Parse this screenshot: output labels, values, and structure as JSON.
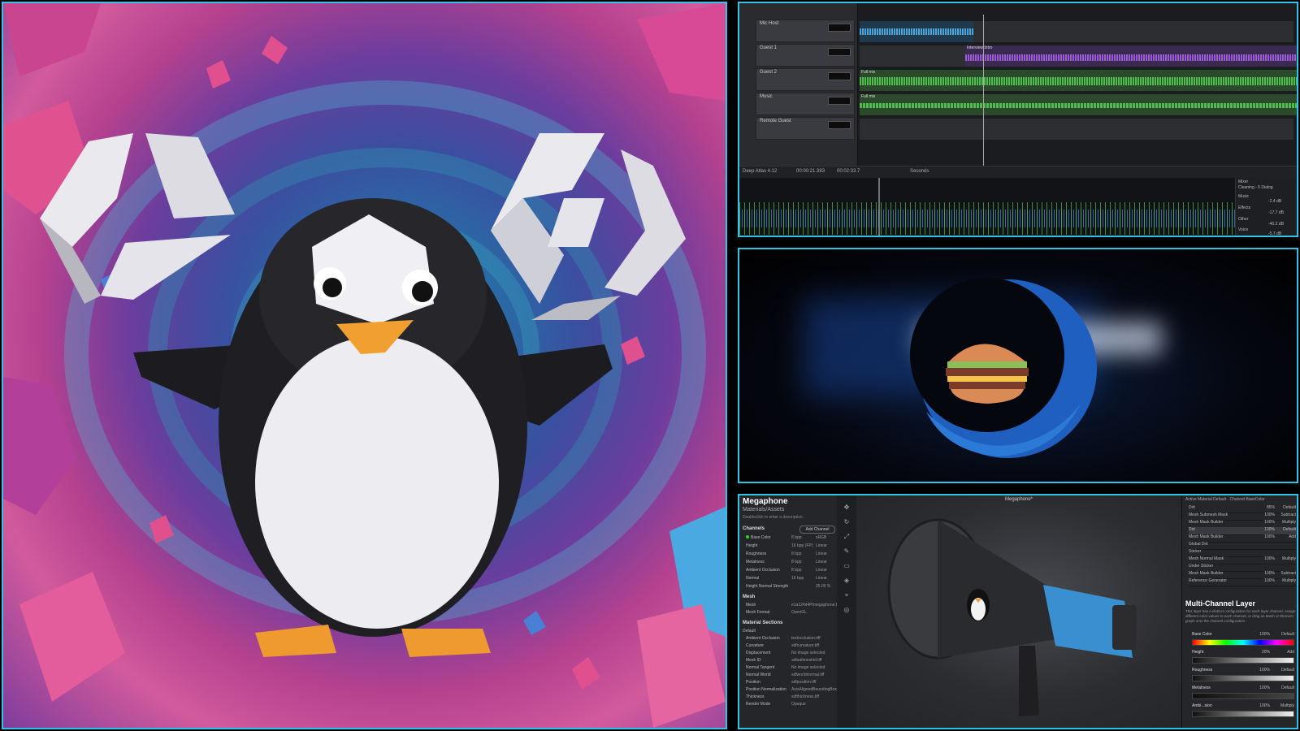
{
  "daw": {
    "tracks": [
      {
        "name": "Mic Host"
      },
      {
        "name": "Guest 1"
      },
      {
        "name": "Guest 2"
      },
      {
        "name": "Music"
      },
      {
        "name": "Remote Guest"
      }
    ],
    "lane_clips": [
      {
        "label": "",
        "color": "#4aa6d6"
      },
      {
        "label": "Interview Intro",
        "color": "#9b5bd6"
      },
      {
        "label": "Full mix",
        "color": "#4fbf4f"
      },
      {
        "label": "Full mix",
        "color": "#4fbf4f"
      },
      {
        "label": "",
        "color": "#333"
      }
    ],
    "transport": {
      "project": "Deep Atlas 4.12",
      "time_a": "00:00:21.383",
      "time_b": "00:02:33.7",
      "snap": "Seconds"
    },
    "mixer": {
      "header": "Mixer",
      "preset": "Cleaning - 6 Dialog",
      "rows": [
        {
          "label": "Music",
          "value": "-2.4 dB"
        },
        {
          "label": "Effects",
          "value": "-17.7 dB"
        },
        {
          "label": "Other",
          "value": "-40.2 dB"
        },
        {
          "label": "Voice",
          "value": "-5.7 dB"
        }
      ]
    }
  },
  "painter": {
    "material_title": "Megaphone",
    "material_path": "Materials/Assets",
    "description_hint": "Doubleclick to enter a description.",
    "channels_header": "Channels",
    "add_channel": "Add Channel",
    "channels": [
      {
        "name": "Base Color",
        "depth": "8 bpp",
        "space": "sRGB"
      },
      {
        "name": "Height",
        "depth": "16 bpp (FP)",
        "space": "Linear"
      },
      {
        "name": "Roughness",
        "depth": "8 bpp",
        "space": "Linear"
      },
      {
        "name": "Metalness",
        "depth": "8 bpp",
        "space": "Linear"
      },
      {
        "name": "Ambient Occlusion",
        "depth": "8 bpp",
        "space": "Linear"
      },
      {
        "name": "Normal",
        "depth": "16 bpp",
        "space": "Linear"
      },
      {
        "name": "Height Normal Strength",
        "depth": "25.00 %",
        "space": ""
      }
    ],
    "mesh_header": "Mesh",
    "mesh": [
      {
        "name": "Mesh",
        "value": "e1a124d4P/megaphone.fbx"
      },
      {
        "name": "Mesh Format",
        "value": "OpenGL"
      }
    ],
    "material_sections_header": "Material Sections",
    "default_label": "Default",
    "maps": [
      {
        "name": "Ambient Occlusion",
        "value": "textocclusion.tiff"
      },
      {
        "name": "Curvature",
        "value": "sdfcurvature.tiff"
      },
      {
        "name": "Displacement",
        "value": "No image selected"
      },
      {
        "name": "Mesh ID",
        "value": "sdfaultmeshid.tiff"
      },
      {
        "name": "Normal Tangent",
        "value": "No image selected"
      },
      {
        "name": "Normal World",
        "value": "sdfworldnormal.tiff"
      },
      {
        "name": "Position",
        "value": "sdfposition.tiff"
      },
      {
        "name": "Position Normalization",
        "value": "AxisAlignedBoundingBox"
      },
      {
        "name": "Thickness",
        "value": "sdfthickness.tiff"
      },
      {
        "name": "Render Mode",
        "value": "Opaque"
      }
    ],
    "viewport_title": "Megaphone*",
    "right_header": "Active Material  Default  ·  Channel  BaseColor",
    "layers": [
      {
        "name": "Dirt",
        "pct": "85%",
        "mode": "Default"
      },
      {
        "name": "Mesh Submesh Mask",
        "pct": "100%",
        "mode": "Subtract"
      },
      {
        "name": "Mesh Mask Builder",
        "pct": "100%",
        "mode": "Multiply"
      },
      {
        "name": "Dirt",
        "pct": "100%",
        "mode": "Default"
      },
      {
        "name": "Mesh Mask Builder",
        "pct": "100%",
        "mode": "Add"
      },
      {
        "name": "Global Dirt",
        "pct": "",
        "mode": ""
      },
      {
        "name": "Sticker",
        "pct": "",
        "mode": ""
      },
      {
        "name": "Mesh Normal Mask",
        "pct": "100%",
        "mode": "Multiply"
      },
      {
        "name": "Under Sticker",
        "pct": "",
        "mode": ""
      },
      {
        "name": "Mesh Mask Builder",
        "pct": "100%",
        "mode": "Subtract"
      },
      {
        "name": "Reference Generator",
        "pct": "100%",
        "mode": "Multiply"
      }
    ],
    "mcl_title": "Multi-Channel Layer",
    "mcl_desc": "This layer has a distinct configuration for each layer channel. Assign different color values to each channel, or drag an Mesh or Element graph onto the channel configuration.",
    "mcl_channels": [
      {
        "name": "Base Color",
        "pct": "100%",
        "mode": "Default",
        "bar": "rainbow"
      },
      {
        "name": "Height",
        "pct": "20%",
        "mode": "Add",
        "bar": "gray"
      },
      {
        "name": "Roughness",
        "pct": "100%",
        "mode": "Default",
        "bar": "gray"
      },
      {
        "name": "Metalness",
        "pct": "100%",
        "mode": "Default",
        "bar": "dark"
      },
      {
        "name": "Ambi...sion",
        "pct": "100%",
        "mode": "Multiply",
        "bar": "gray"
      }
    ]
  }
}
